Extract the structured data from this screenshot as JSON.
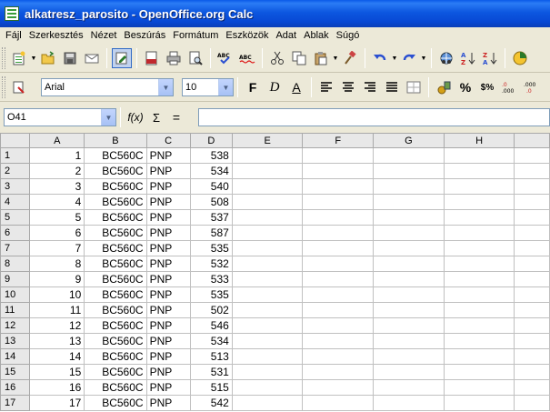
{
  "window": {
    "title": "alkatresz_parosito - OpenOffice.org Calc"
  },
  "menu": [
    "Fájl",
    "Szerkesztés",
    "Nézet",
    "Beszúrás",
    "Formátum",
    "Eszközök",
    "Adat",
    "Ablak",
    "Súgó"
  ],
  "format_toolbar": {
    "font_name": "Arial",
    "font_size": "10",
    "bold": "F",
    "italic": "D",
    "underline": "A",
    "percent": "%",
    "currency": "$%"
  },
  "formula_bar": {
    "name_box": "O41",
    "fx": "f(x)",
    "sigma": "Σ",
    "equals": "=",
    "content": ""
  },
  "sheet": {
    "columns": [
      "A",
      "B",
      "C",
      "D",
      "E",
      "F",
      "G",
      "H"
    ],
    "rows": [
      {
        "n": "1",
        "a": "1",
        "b": "BC560C",
        "c": "PNP",
        "d": "538"
      },
      {
        "n": "2",
        "a": "2",
        "b": "BC560C",
        "c": "PNP",
        "d": "534"
      },
      {
        "n": "3",
        "a": "3",
        "b": "BC560C",
        "c": "PNP",
        "d": "540"
      },
      {
        "n": "4",
        "a": "4",
        "b": "BC560C",
        "c": "PNP",
        "d": "508"
      },
      {
        "n": "5",
        "a": "5",
        "b": "BC560C",
        "c": "PNP",
        "d": "537"
      },
      {
        "n": "6",
        "a": "6",
        "b": "BC560C",
        "c": "PNP",
        "d": "587"
      },
      {
        "n": "7",
        "a": "7",
        "b": "BC560C",
        "c": "PNP",
        "d": "535"
      },
      {
        "n": "8",
        "a": "8",
        "b": "BC560C",
        "c": "PNP",
        "d": "532"
      },
      {
        "n": "9",
        "a": "9",
        "b": "BC560C",
        "c": "PNP",
        "d": "533"
      },
      {
        "n": "10",
        "a": "10",
        "b": "BC560C",
        "c": "PNP",
        "d": "535"
      },
      {
        "n": "11",
        "a": "11",
        "b": "BC560C",
        "c": "PNP",
        "d": "502"
      },
      {
        "n": "12",
        "a": "12",
        "b": "BC560C",
        "c": "PNP",
        "d": "546"
      },
      {
        "n": "13",
        "a": "13",
        "b": "BC560C",
        "c": "PNP",
        "d": "534"
      },
      {
        "n": "14",
        "a": "14",
        "b": "BC560C",
        "c": "PNP",
        "d": "513"
      },
      {
        "n": "15",
        "a": "15",
        "b": "BC560C",
        "c": "PNP",
        "d": "531"
      },
      {
        "n": "16",
        "a": "16",
        "b": "BC560C",
        "c": "PNP",
        "d": "515"
      },
      {
        "n": "17",
        "a": "17",
        "b": "BC560C",
        "c": "PNP",
        "d": "542"
      }
    ]
  },
  "icons": {
    "toolbar1": [
      "new-document-icon",
      "open-folder-icon",
      "save-icon",
      "email-icon",
      "edit-file-icon",
      "export-pdf-icon",
      "print-icon",
      "page-preview-icon",
      "spellcheck-icon",
      "autospellcheck-icon",
      "cut-icon",
      "copy-icon",
      "paste-icon",
      "format-paintbrush-icon",
      "undo-icon",
      "redo-icon",
      "hyperlink-icon",
      "sort-ascending-icon",
      "sort-descending-icon",
      "chart-icon"
    ]
  }
}
